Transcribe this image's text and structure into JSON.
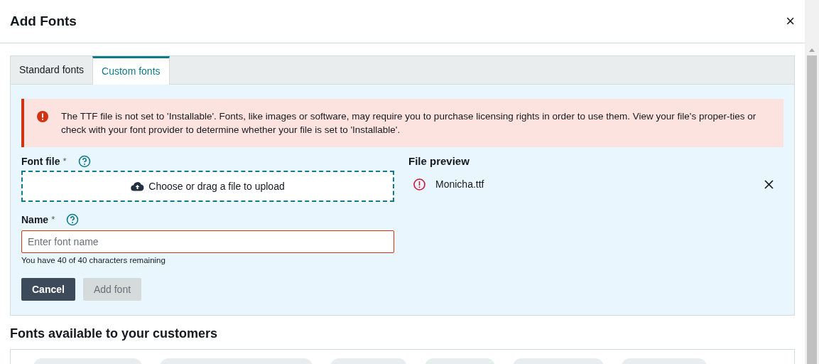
{
  "dialog": {
    "title": "Add Fonts",
    "close": "×"
  },
  "tabs": [
    {
      "label": "Standard fonts",
      "selected": false
    },
    {
      "label": "Custom fonts",
      "selected": true
    }
  ],
  "alert": {
    "kind": "error",
    "message": "The TTF file is not set to 'Installable'. Fonts, like images or software, may require you to purchase licensing rights in order to use them. View your file's proper-ties or check with your font provider to determine whether your file is set to 'Installable'."
  },
  "font_file": {
    "label": "Font file",
    "required": "*",
    "upload_text": "Choose or drag a file to upload"
  },
  "name": {
    "label": "Name",
    "required": "*",
    "placeholder": "Enter font name",
    "invalid": true,
    "hint": "You have 40 of 40 characters remaining"
  },
  "buttons": [
    {
      "label": "Cancel",
      "disabled": false
    },
    {
      "label": "Add font",
      "disabled": true
    }
  ],
  "file_preview": {
    "title": "File preview",
    "files": [
      {
        "name": "Monicha.ttf",
        "error": true
      }
    ]
  },
  "fonts_section": {
    "title": "Fonts available to your customers"
  }
}
